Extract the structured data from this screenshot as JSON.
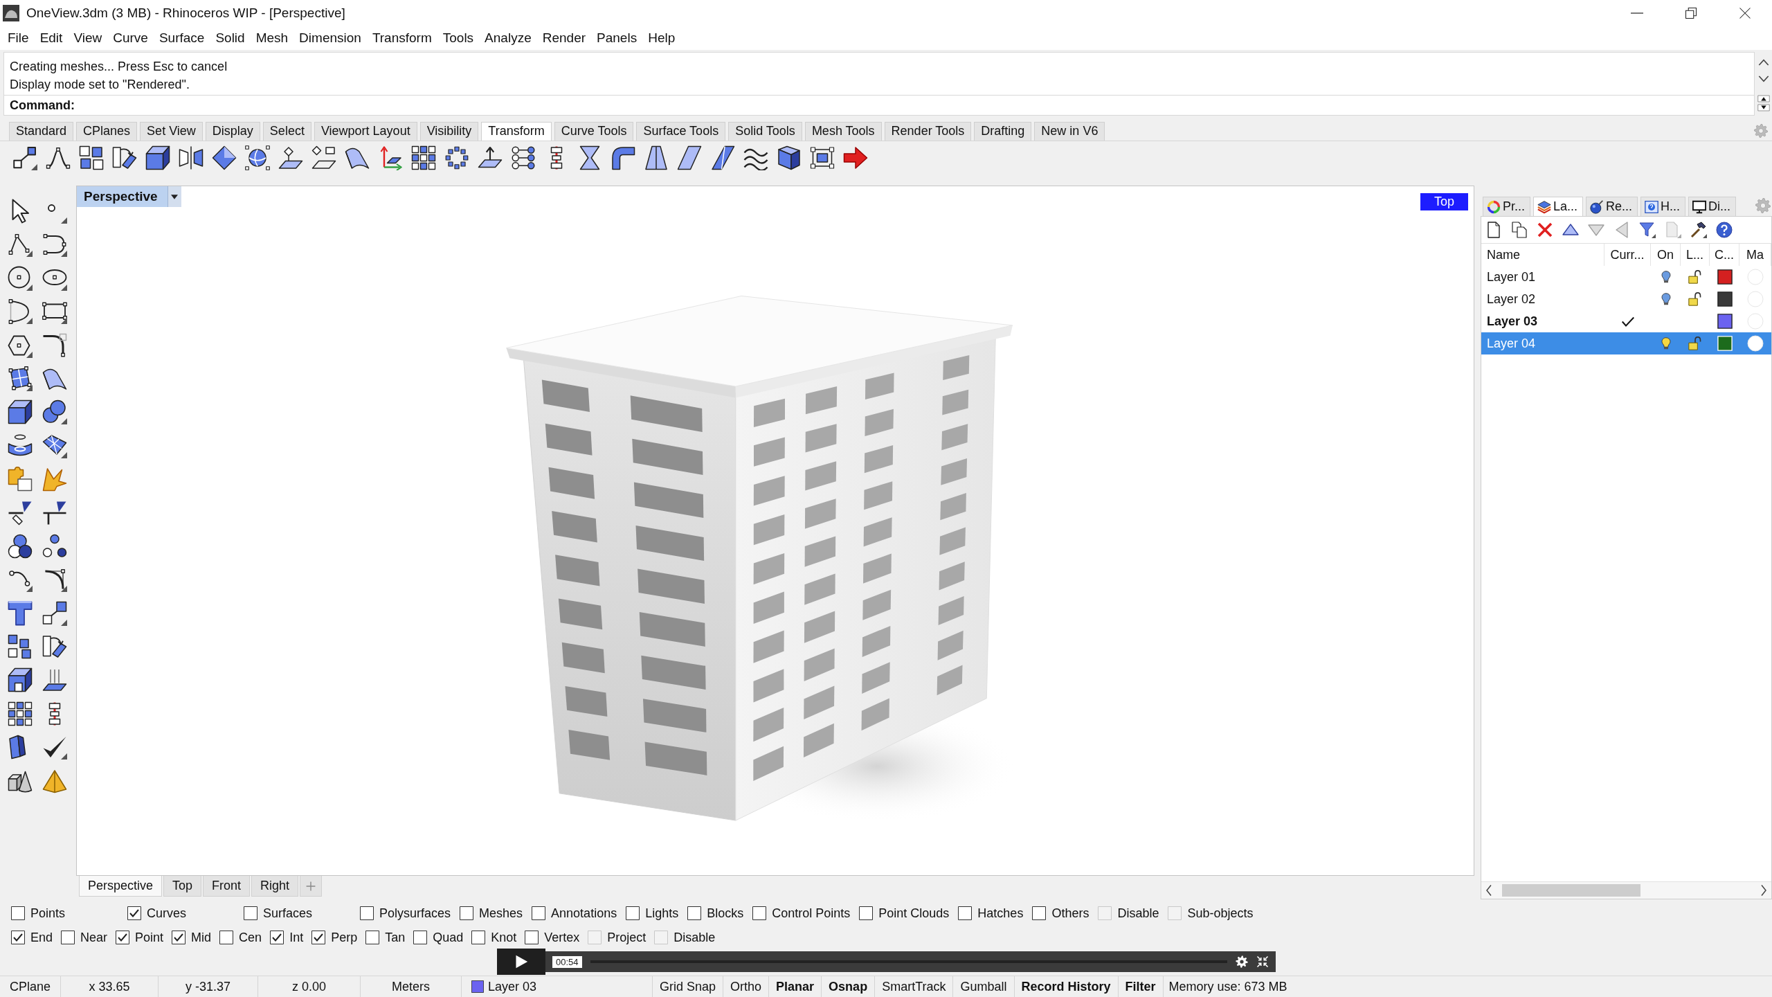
{
  "window": {
    "title": "OneView.3dm (3 MB) - Rhinoceros WIP - [Perspective]"
  },
  "menu": [
    "File",
    "Edit",
    "View",
    "Curve",
    "Surface",
    "Solid",
    "Mesh",
    "Dimension",
    "Transform",
    "Tools",
    "Analyze",
    "Render",
    "Panels",
    "Help"
  ],
  "command_history": [
    "Creating meshes... Press Esc to cancel",
    "Display mode set to \"Rendered\"."
  ],
  "command_prompt": "Command:",
  "toolbar_tabs": [
    {
      "label": "Standard",
      "selected": false
    },
    {
      "label": "CPlanes",
      "selected": false
    },
    {
      "label": "Set View",
      "selected": false
    },
    {
      "label": "Display",
      "selected": false
    },
    {
      "label": "Select",
      "selected": false
    },
    {
      "label": "Viewport Layout",
      "selected": false
    },
    {
      "label": "Visibility",
      "selected": false
    },
    {
      "label": "Transform",
      "selected": true
    },
    {
      "label": "Curve Tools",
      "selected": false
    },
    {
      "label": "Surface Tools",
      "selected": false
    },
    {
      "label": "Solid Tools",
      "selected": false
    },
    {
      "label": "Mesh Tools",
      "selected": false
    },
    {
      "label": "Render Tools",
      "selected": false
    },
    {
      "label": "Drafting",
      "selected": false
    },
    {
      "label": "New in V6",
      "selected": false
    }
  ],
  "viewport": {
    "title": "Perspective",
    "view_label": "Top",
    "tabs": [
      {
        "label": "Perspective",
        "selected": true
      },
      {
        "label": "Top",
        "selected": false
      },
      {
        "label": "Front",
        "selected": false
      },
      {
        "label": "Right",
        "selected": false
      }
    ]
  },
  "panel": {
    "tabs": [
      {
        "label": "Pr...",
        "selected": false
      },
      {
        "label": "La...",
        "selected": true
      },
      {
        "label": "Re...",
        "selected": false
      },
      {
        "label": "H...",
        "selected": false
      },
      {
        "label": "Di...",
        "selected": false
      }
    ],
    "toolbar": [
      {
        "disabled": false
      },
      {
        "disabled": false
      },
      {
        "disabled": false
      },
      {
        "disabled": false
      },
      {
        "disabled": true
      },
      {
        "disabled": true
      },
      {
        "disabled": false
      },
      {
        "disabled": true
      },
      {
        "disabled": false
      },
      {
        "disabled": false
      }
    ],
    "columns": [
      "Name",
      "Curr...",
      "On",
      "L...",
      "C...",
      "Ma"
    ],
    "layers": [
      {
        "name": "Layer 01",
        "selected": false,
        "current": false,
        "on": true,
        "locked": false,
        "color": "#d42020"
      },
      {
        "name": "Layer 02",
        "selected": false,
        "current": false,
        "on": true,
        "locked": false,
        "color": "#3a3a3a"
      },
      {
        "name": "Layer 03",
        "selected": false,
        "current": true,
        "color": "#6b63f0"
      },
      {
        "name": "Layer 04",
        "selected": true,
        "current": false,
        "on": true,
        "locked": false,
        "color": "#1c6b1c"
      }
    ]
  },
  "object_filters": [
    {
      "label": "Points",
      "checked": false,
      "disabled": false
    },
    {
      "label": "Curves",
      "checked": true,
      "disabled": false
    },
    {
      "label": "Surfaces",
      "checked": false,
      "disabled": false
    },
    {
      "label": "Polysurfaces",
      "checked": false,
      "disabled": false
    },
    {
      "label": "Meshes",
      "checked": false,
      "disabled": false
    },
    {
      "label": "Annotations",
      "checked": false,
      "disabled": false
    },
    {
      "label": "Lights",
      "checked": false,
      "disabled": false
    },
    {
      "label": "Blocks",
      "checked": false,
      "disabled": false
    },
    {
      "label": "Control Points",
      "checked": false,
      "disabled": false
    },
    {
      "label": "Point Clouds",
      "checked": false,
      "disabled": false
    },
    {
      "label": "Hatches",
      "checked": false,
      "disabled": false
    },
    {
      "label": "Others",
      "checked": false,
      "disabled": false
    },
    {
      "label": "Disable",
      "checked": false,
      "disabled": true
    },
    {
      "label": "Sub-objects",
      "checked": false,
      "disabled": true
    }
  ],
  "osnaps": [
    {
      "label": "End",
      "checked": true,
      "disabled": false
    },
    {
      "label": "Near",
      "checked": false,
      "disabled": false
    },
    {
      "label": "Point",
      "checked": true,
      "disabled": false
    },
    {
      "label": "Mid",
      "checked": true,
      "disabled": false
    },
    {
      "label": "Cen",
      "checked": false,
      "disabled": false
    },
    {
      "label": "Int",
      "checked": true,
      "disabled": false
    },
    {
      "label": "Perp",
      "checked": true,
      "disabled": false
    },
    {
      "label": "Tan",
      "checked": false,
      "disabled": false
    },
    {
      "label": "Quad",
      "checked": false,
      "disabled": false
    },
    {
      "label": "Knot",
      "checked": false,
      "disabled": false
    },
    {
      "label": "Vertex",
      "checked": false,
      "disabled": false
    },
    {
      "label": "Project",
      "checked": false,
      "disabled": true
    },
    {
      "label": "Disable",
      "checked": false,
      "disabled": true
    }
  ],
  "status_bar": {
    "cplane": "CPlane",
    "x": "x 33.65",
    "y": "y -31.37",
    "z": "z 0.00",
    "units": "Meters",
    "layer": {
      "name": "Layer 03",
      "color": "#6b63f0"
    },
    "toggles": [
      {
        "label": "Grid Snap",
        "on": false
      },
      {
        "label": "Ortho",
        "on": false
      },
      {
        "label": "Planar",
        "on": true
      },
      {
        "label": "Osnap",
        "on": true
      },
      {
        "label": "SmartTrack",
        "on": false
      },
      {
        "label": "Gumball",
        "on": false
      },
      {
        "label": "Record History",
        "on": true
      },
      {
        "label": "Filter",
        "on": true
      }
    ],
    "memory": "Memory use: 673 MB"
  },
  "video_player": {
    "time": "00:54"
  }
}
